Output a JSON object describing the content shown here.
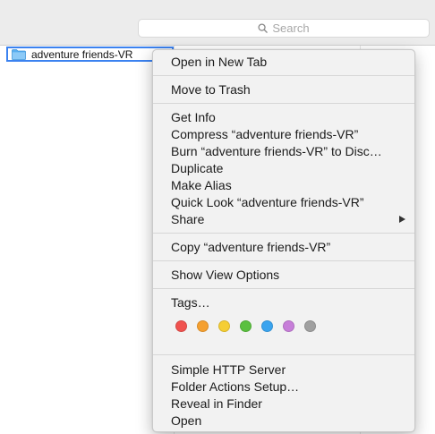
{
  "toolbar": {
    "search": {
      "placeholder": "Search",
      "icon": "magnifier-icon"
    }
  },
  "files": [
    {
      "name": "adventure friends-VR",
      "icon": "folder-icon",
      "selected": true
    }
  ],
  "context_menu": {
    "groups": [
      [
        "Open in New Tab"
      ],
      [
        "Move to Trash"
      ],
      [
        "Get Info",
        "Compress “adventure friends-VR”",
        "Burn “adventure friends-VR” to Disc…",
        "Duplicate",
        "Make Alias",
        "Quick Look “adventure friends-VR”",
        "Share"
      ],
      [
        "Copy “adventure friends-VR”"
      ],
      [
        "Show View Options"
      ],
      [
        "Tags…"
      ],
      [
        "Simple HTTP Server",
        "Folder Actions Setup…",
        "Reveal in Finder",
        "Open"
      ]
    ],
    "share_has_submenu": true,
    "tag_colors": [
      {
        "name": "red",
        "color": "#f0524f"
      },
      {
        "name": "orange",
        "color": "#f5a030"
      },
      {
        "name": "yellow",
        "color": "#f5ce34"
      },
      {
        "name": "green",
        "color": "#5ac03f"
      },
      {
        "name": "blue",
        "color": "#3aa4ef"
      },
      {
        "name": "purple",
        "color": "#c77ed9"
      },
      {
        "name": "gray",
        "color": "#a0a0a0"
      }
    ]
  }
}
